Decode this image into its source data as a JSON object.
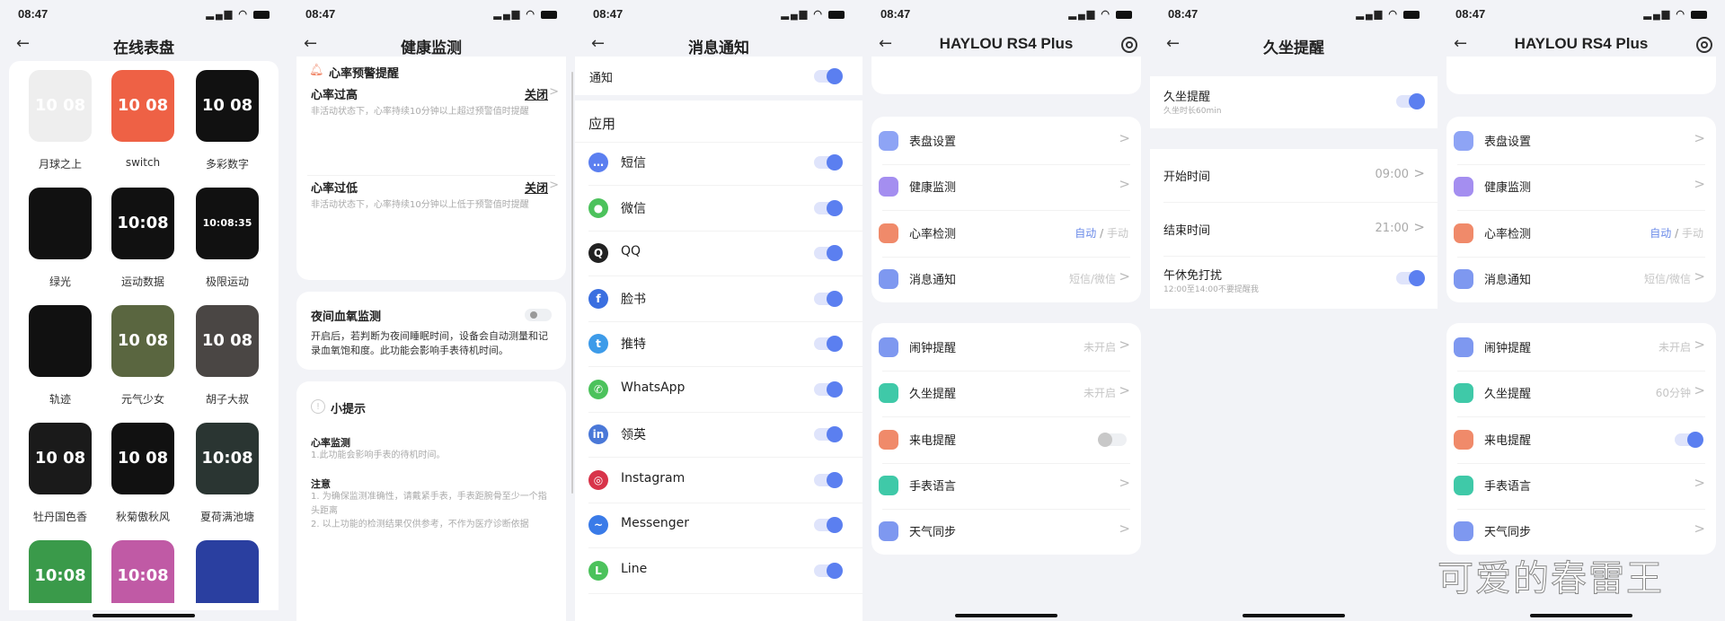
{
  "status": {
    "time": "08:47"
  },
  "accent": "#5b7ff0",
  "watchfaces": {
    "title": "在线表盘",
    "items": [
      {
        "name": "月球之上",
        "face": "10 08",
        "bg": "#eeeeee"
      },
      {
        "name": "switch",
        "face": "10 08",
        "bg": "#ee6145"
      },
      {
        "name": "多彩数字",
        "face": "10 08",
        "bg": "#111111"
      },
      {
        "name": "绿光",
        "face": "",
        "bg": "#111111"
      },
      {
        "name": "运动数据",
        "face": "10:08",
        "bg": "#111111"
      },
      {
        "name": "极限运动",
        "face": "10:08:35",
        "bg": "#111111"
      },
      {
        "name": "轨迹",
        "face": "",
        "bg": "#111111"
      },
      {
        "name": "元气少女",
        "face": "10 08",
        "bg": "#5a6640"
      },
      {
        "name": "胡子大叔",
        "face": "10 08",
        "bg": "#4a4644"
      },
      {
        "name": "牡丹国色香",
        "face": "10 08",
        "bg": "#1a1a1a"
      },
      {
        "name": "秋菊傲秋风",
        "face": "10 08",
        "bg": "#111111"
      },
      {
        "name": "夏荷满池塘",
        "face": "10:08",
        "bg": "#2a3532"
      },
      {
        "name": "",
        "face": "10:08",
        "bg": "#3a9a4a"
      },
      {
        "name": "",
        "face": "10:08",
        "bg": "#c05aa5"
      },
      {
        "name": "",
        "face": "",
        "bg": "#2a3fa0"
      }
    ]
  },
  "health": {
    "title": "健康监测",
    "alert_header": "心率预警提醒",
    "high": {
      "label": "心率过高",
      "value": "关闭",
      "desc": "非活动状态下，心率持续10分钟以上超过预警值时提醒"
    },
    "low": {
      "label": "心率过低",
      "value": "关闭",
      "desc": "非活动状态下，心率持续10分钟以上低于预警值时提醒"
    },
    "spo2": {
      "label": "夜间血氧监测",
      "desc": "开启后，若判断为夜间睡眠时间，设备会自动测量和记录血氧饱和度。此功能会影响手表待机时间。",
      "enabled": false
    },
    "tips": {
      "title": "小提示",
      "h1": "心率监测",
      "t1": "1.此功能会影响手表的待机时间。",
      "h2": "注意",
      "t2": "1. 为确保监测准确性，请戴紧手表，手表距腕骨至少一个指头距离",
      "t3": "2. 以上功能的检测结果仅供参考，不作为医疗诊断依据"
    }
  },
  "notify": {
    "title": "消息通知",
    "master": {
      "label": "通知",
      "enabled": true
    },
    "section": "应用",
    "apps": [
      {
        "label": "短信",
        "icon": "sms-icon",
        "color": "#5b7ff0",
        "glyph": "…",
        "enabled": true
      },
      {
        "label": "微信",
        "icon": "wechat-icon",
        "color": "#4cc25c",
        "glyph": "●",
        "enabled": true
      },
      {
        "label": "QQ",
        "icon": "qq-icon",
        "color": "#222222",
        "glyph": "Q",
        "enabled": true
      },
      {
        "label": "脸书",
        "icon": "facebook-icon",
        "color": "#3a6fe0",
        "glyph": "f",
        "enabled": true
      },
      {
        "label": "推特",
        "icon": "twitter-icon",
        "color": "#3d9be9",
        "glyph": "t",
        "enabled": true
      },
      {
        "label": "WhatsApp",
        "icon": "whatsapp-icon",
        "color": "#4cc25c",
        "glyph": "✆",
        "enabled": true
      },
      {
        "label": "领英",
        "icon": "linkedin-icon",
        "color": "#4a78d8",
        "glyph": "in",
        "enabled": true
      },
      {
        "label": "Instagram",
        "icon": "instagram-icon",
        "color": "#d8344a",
        "glyph": "◎",
        "enabled": true
      },
      {
        "label": "Messenger",
        "icon": "messenger-icon",
        "color": "#3a7be8",
        "glyph": "~",
        "enabled": true
      },
      {
        "label": "Line",
        "icon": "line-icon",
        "color": "#4cc25c",
        "glyph": "L",
        "enabled": true
      }
    ]
  },
  "device_a": {
    "title": "HAYLOU RS4 Plus",
    "group1": [
      {
        "label": "表盘设置",
        "icon": "watchface-icon",
        "color": "#8ea4f5",
        "value": "",
        "chev": true
      },
      {
        "label": "健康监测",
        "icon": "health-plus-icon",
        "color": "#a48ef0",
        "value": "",
        "chev": true
      },
      {
        "label": "心率检测",
        "icon": "heart-icon",
        "color": "#f08a6a",
        "value": "自动",
        "value2": "手动",
        "chev": false
      },
      {
        "label": "消息通知",
        "icon": "message-icon",
        "color": "#7e98f0",
        "value": "短信/微信",
        "chev": true
      }
    ],
    "group2": [
      {
        "label": "闹钟提醒",
        "icon": "alarm-icon",
        "color": "#7e98f0",
        "value": "未开启",
        "chev": true
      },
      {
        "label": "久坐提醒",
        "icon": "sedentary-icon",
        "color": "#3fc9a8",
        "value": "未开启",
        "chev": true
      },
      {
        "label": "来电提醒",
        "icon": "call-icon",
        "color": "#f08a6a",
        "value": "",
        "toggle": false
      },
      {
        "label": "手表语言",
        "icon": "language-icon",
        "color": "#3fc9a8",
        "value": "",
        "chev": true
      },
      {
        "label": "天气同步",
        "icon": "weather-icon",
        "color": "#7e98f0",
        "value": "",
        "chev": true
      }
    ]
  },
  "sedentary": {
    "title": "久坐提醒",
    "main": {
      "label": "久坐提醒",
      "sub": "久坐时长60min",
      "enabled": true
    },
    "start": {
      "label": "开始时间",
      "value": "09:00"
    },
    "end": {
      "label": "结束时间",
      "value": "21:00"
    },
    "nap": {
      "label": "午休免打扰",
      "sub": "12:00至14:00不要提醒我",
      "enabled": true
    }
  },
  "device_b": {
    "title": "HAYLOU RS4 Plus",
    "group1": [
      {
        "label": "表盘设置",
        "icon": "watchface-icon",
        "color": "#8ea4f5",
        "value": "",
        "chev": true
      },
      {
        "label": "健康监测",
        "icon": "health-plus-icon",
        "color": "#a48ef0",
        "value": "",
        "chev": true
      },
      {
        "label": "心率检测",
        "icon": "heart-icon",
        "color": "#f08a6a",
        "value": "自动",
        "value2": "手动",
        "chev": false
      },
      {
        "label": "消息通知",
        "icon": "message-icon",
        "color": "#7e98f0",
        "value": "短信/微信",
        "chev": true
      }
    ],
    "group2": [
      {
        "label": "闹钟提醒",
        "icon": "alarm-icon",
        "color": "#7e98f0",
        "value": "未开启",
        "chev": true
      },
      {
        "label": "久坐提醒",
        "icon": "sedentary-icon",
        "color": "#3fc9a8",
        "value": "60分钟",
        "chev": true
      },
      {
        "label": "来电提醒",
        "icon": "call-icon",
        "color": "#f08a6a",
        "value": "",
        "toggle": true
      },
      {
        "label": "手表语言",
        "icon": "language-icon",
        "color": "#3fc9a8",
        "value": "",
        "chev": true
      },
      {
        "label": "天气同步",
        "icon": "weather-icon",
        "color": "#7e98f0",
        "value": "",
        "chev": true
      }
    ]
  },
  "watermark": "可爱的春雷王"
}
